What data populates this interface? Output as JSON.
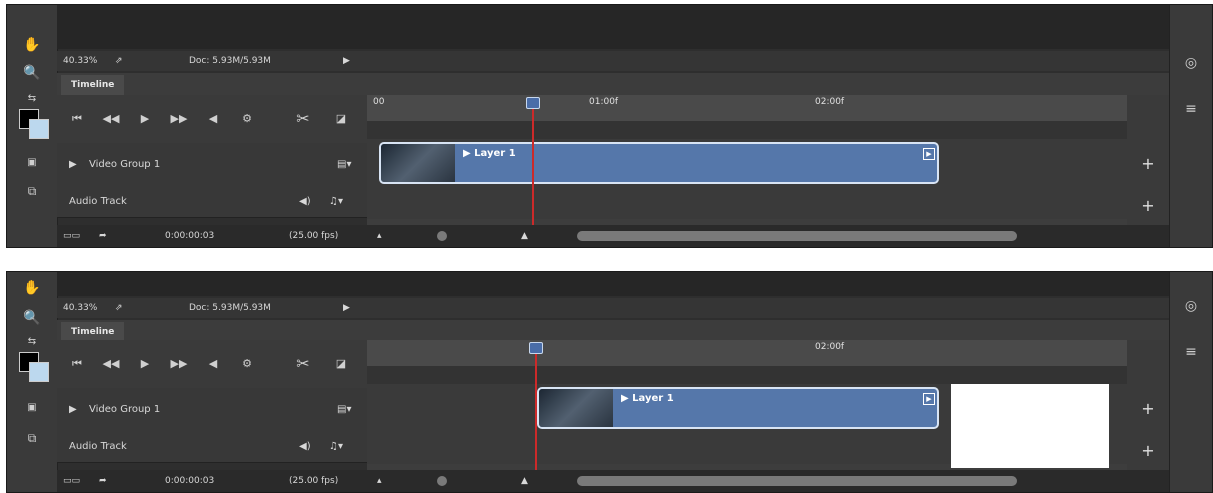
{
  "panels": [
    {
      "zoom": "40.33%",
      "doc": "Doc: 5.93M/5.93M",
      "tab": "Timeline",
      "ruler": [
        "00",
        "01:00f",
        "02:00f"
      ],
      "track": "Video Group 1",
      "audio": "Audio Track",
      "clip": "Layer 1",
      "timecode": "0:00:00:03",
      "fps": "(25.00 fps)"
    },
    {
      "zoom": "40.33%",
      "doc": "Doc: 5.93M/5.93M",
      "tab": "Timeline",
      "ruler": [
        "",
        "",
        "02:00f"
      ],
      "track": "Video Group 1",
      "audio": "Audio Track",
      "clip": "Layer 1",
      "timecode": "0:00:00:03",
      "fps": "(25.00 fps)"
    }
  ],
  "icons": [
    "hand-icon",
    "zoom-icon",
    "swap-colors-icon",
    "foreground-color-icon",
    "screen-mode-icon",
    "layers-icon",
    "first-frame-icon",
    "previous-frame-icon",
    "play-icon",
    "next-frame-icon",
    "audio-mute-icon",
    "settings-icon",
    "scissors-icon",
    "transition-icon",
    "film-strip-icon",
    "music-note-icon",
    "render-icon",
    "export-icon",
    "zoom-out-icon",
    "zoom-in-icon",
    "add-icon",
    "layers-panel-icon",
    "adjustments-icon"
  ]
}
